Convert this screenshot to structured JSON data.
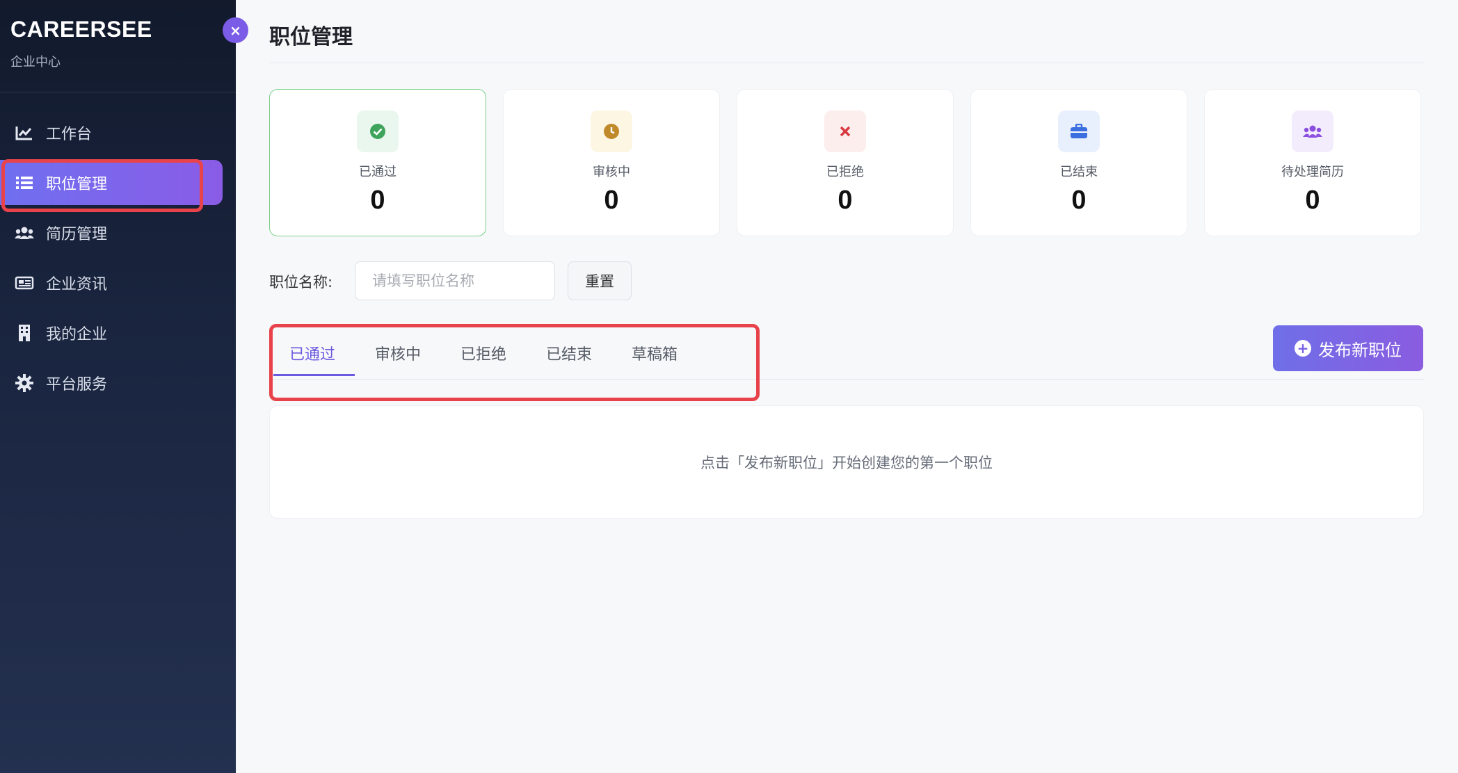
{
  "sidebar": {
    "brand_title": "CAREERSEE",
    "brand_subtitle": "企业中心",
    "collapse_glyph": "×",
    "items": [
      {
        "label": "工作台",
        "icon": "chart-line-icon"
      },
      {
        "label": "职位管理",
        "icon": "list-icon"
      },
      {
        "label": "简历管理",
        "icon": "users-icon"
      },
      {
        "label": "企业资讯",
        "icon": "newspaper-icon"
      },
      {
        "label": "我的企业",
        "icon": "building-icon"
      },
      {
        "label": "平台服务",
        "icon": "gear-icon"
      }
    ]
  },
  "header": {
    "title": "职位管理"
  },
  "stats": [
    {
      "label": "已通过",
      "value": "0",
      "icon": "check-circle-icon",
      "color": "#3fa45b"
    },
    {
      "label": "审核中",
      "value": "0",
      "icon": "clock-icon",
      "color": "#c08a2a"
    },
    {
      "label": "已拒绝",
      "value": "0",
      "icon": "x-icon",
      "color": "#d9363e"
    },
    {
      "label": "已结束",
      "value": "0",
      "icon": "briefcase-icon",
      "color": "#3b6fe0"
    },
    {
      "label": "待处理简历",
      "value": "0",
      "icon": "users-icon",
      "color": "#8a4fe0"
    }
  ],
  "filter": {
    "label": "职位名称:",
    "placeholder": "请填写职位名称",
    "reset_label": "重置"
  },
  "tabs": [
    {
      "label": "已通过"
    },
    {
      "label": "审核中"
    },
    {
      "label": "已拒绝"
    },
    {
      "label": "已结束"
    },
    {
      "label": "草稿箱"
    }
  ],
  "publish_button": {
    "label": "发布新职位",
    "glyph": "+"
  },
  "empty_state": {
    "text": "点击「发布新职位」开始创建您的第一个职位"
  },
  "colors": {
    "accent": "#6a5ae0",
    "highlight": "#e8434a",
    "sidebar_bg": "#1a2540"
  }
}
